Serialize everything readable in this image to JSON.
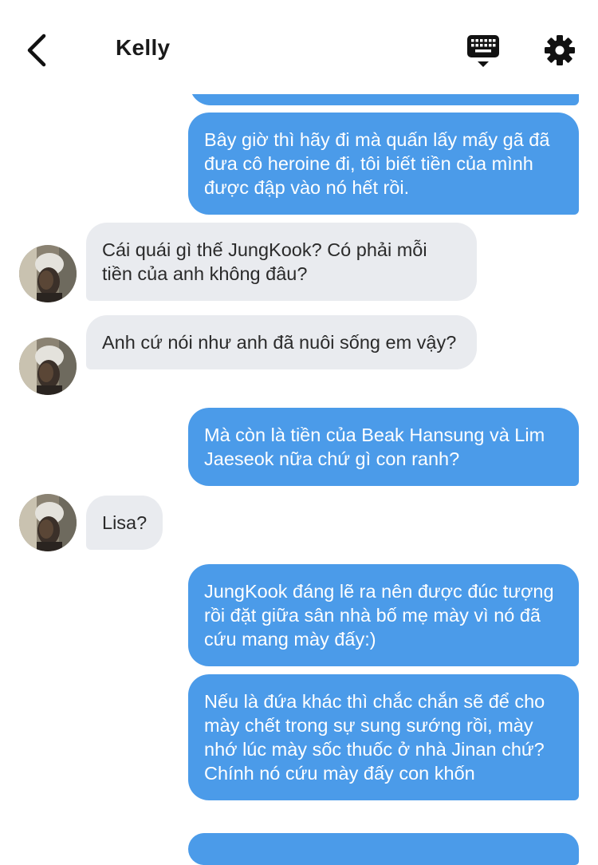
{
  "header": {
    "title": "Kelly",
    "icons": {
      "back": "chevron-left-icon",
      "keyboard": "keyboard-icon",
      "settings": "gear-icon"
    }
  },
  "colors": {
    "sent_bubble": "#4b9be9",
    "received_bubble": "#e9ebef",
    "sent_text": "#ffffff",
    "received_text": "#2a2a2a",
    "icon": "#111111"
  },
  "messages": [
    {
      "side": "sent",
      "text": ""
    },
    {
      "side": "sent",
      "text": "Bây giờ thì hãy đi mà quấn lấy mấy gã đã đưa cô heroine đi, tôi biết tiền của mình được đập vào nó hết rồi."
    },
    {
      "side": "received",
      "text": "Cái quái gì thế JungKook? Có phải mỗi tiền của anh không đâu?"
    },
    {
      "side": "received",
      "text": "Anh cứ nói như anh đã nuôi sống em vậy?"
    },
    {
      "side": "sent",
      "text": "Mà còn là tiền của Beak Hansung và Lim Jaeseok nữa chứ gì con ranh?"
    },
    {
      "side": "received",
      "text": "Lisa?"
    },
    {
      "side": "sent",
      "text": "JungKook đáng lẽ ra nên được đúc tượng rồi đặt giữa sân nhà bố mẹ mày vì nó đã cứu mang mày đấy:)"
    },
    {
      "side": "sent",
      "text": "Nếu là đứa khác thì chắc chắn sẽ để cho mày chết trong sự sung sướng rồi, mày nhớ lúc mày sốc thuốc ở nhà Jinan chứ? Chính nó cứu mày đấy con khốn"
    },
    {
      "side": "sent",
      "text": ""
    }
  ]
}
